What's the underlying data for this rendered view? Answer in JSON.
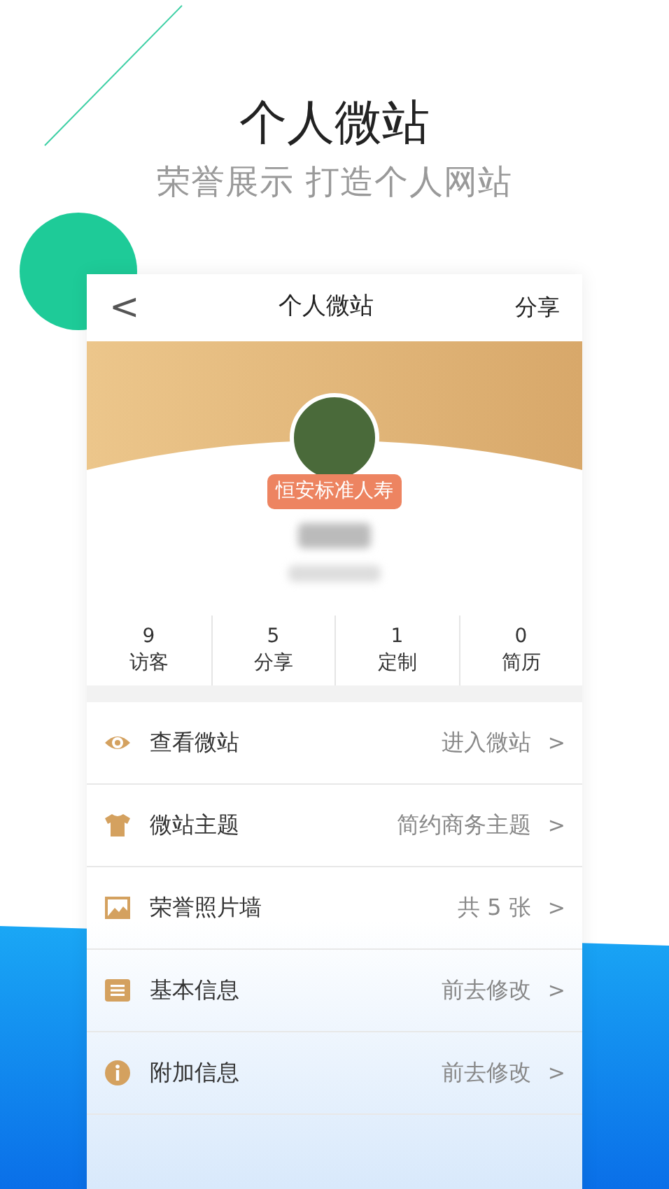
{
  "headline": {
    "title": "个人微站",
    "subtitle": "荣誉展示 打造个人网站"
  },
  "nav": {
    "back": "<",
    "title": "个人微站",
    "action": "分享"
  },
  "profile": {
    "badge": "恒安标准人寿"
  },
  "stats": [
    {
      "value": "9",
      "label": "访客"
    },
    {
      "value": "5",
      "label": "分享"
    },
    {
      "value": "1",
      "label": "定制"
    },
    {
      "value": "0",
      "label": "简历"
    }
  ],
  "menu": [
    {
      "kind": "eye",
      "label": "查看微站",
      "value": "进入微站",
      "chevron": ">"
    },
    {
      "kind": "shirt",
      "label": "微站主题",
      "value": "简约商务主题",
      "chevron": ">"
    },
    {
      "kind": "image",
      "label": "荣誉照片墙",
      "value": "共 5 张",
      "chevron": ">"
    },
    {
      "kind": "form",
      "label": "基本信息",
      "value": "前去修改",
      "chevron": ">"
    },
    {
      "kind": "info",
      "label": "附加信息",
      "value": "前去修改",
      "chevron": ">"
    }
  ]
}
